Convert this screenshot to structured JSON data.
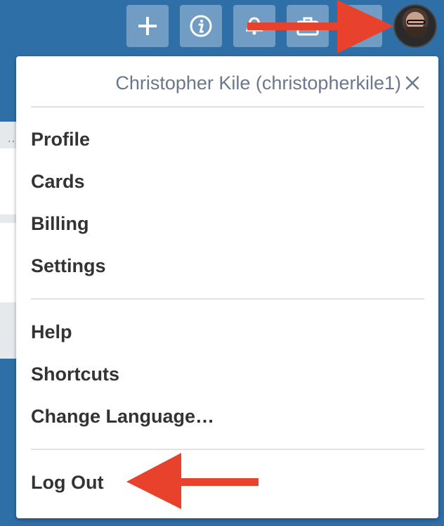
{
  "header": {
    "buttons": [
      {
        "icon": "plus-icon"
      },
      {
        "icon": "info-icon"
      },
      {
        "icon": "bell-icon"
      },
      {
        "icon": "briefcase-icon"
      },
      {
        "icon": "blank-button"
      }
    ],
    "avatar": "profile-avatar"
  },
  "menu": {
    "title": "Christopher Kile (christopherkile1)",
    "close_icon": "close-icon",
    "section1": [
      "Profile",
      "Cards",
      "Billing",
      "Settings"
    ],
    "section2": [
      "Help",
      "Shortcuts",
      "Change Language…"
    ],
    "section3": [
      "Log Out"
    ]
  },
  "annotations": {
    "arrow_color": "#e8412c"
  },
  "background_fragment": {
    "ellipsis": "…"
  }
}
